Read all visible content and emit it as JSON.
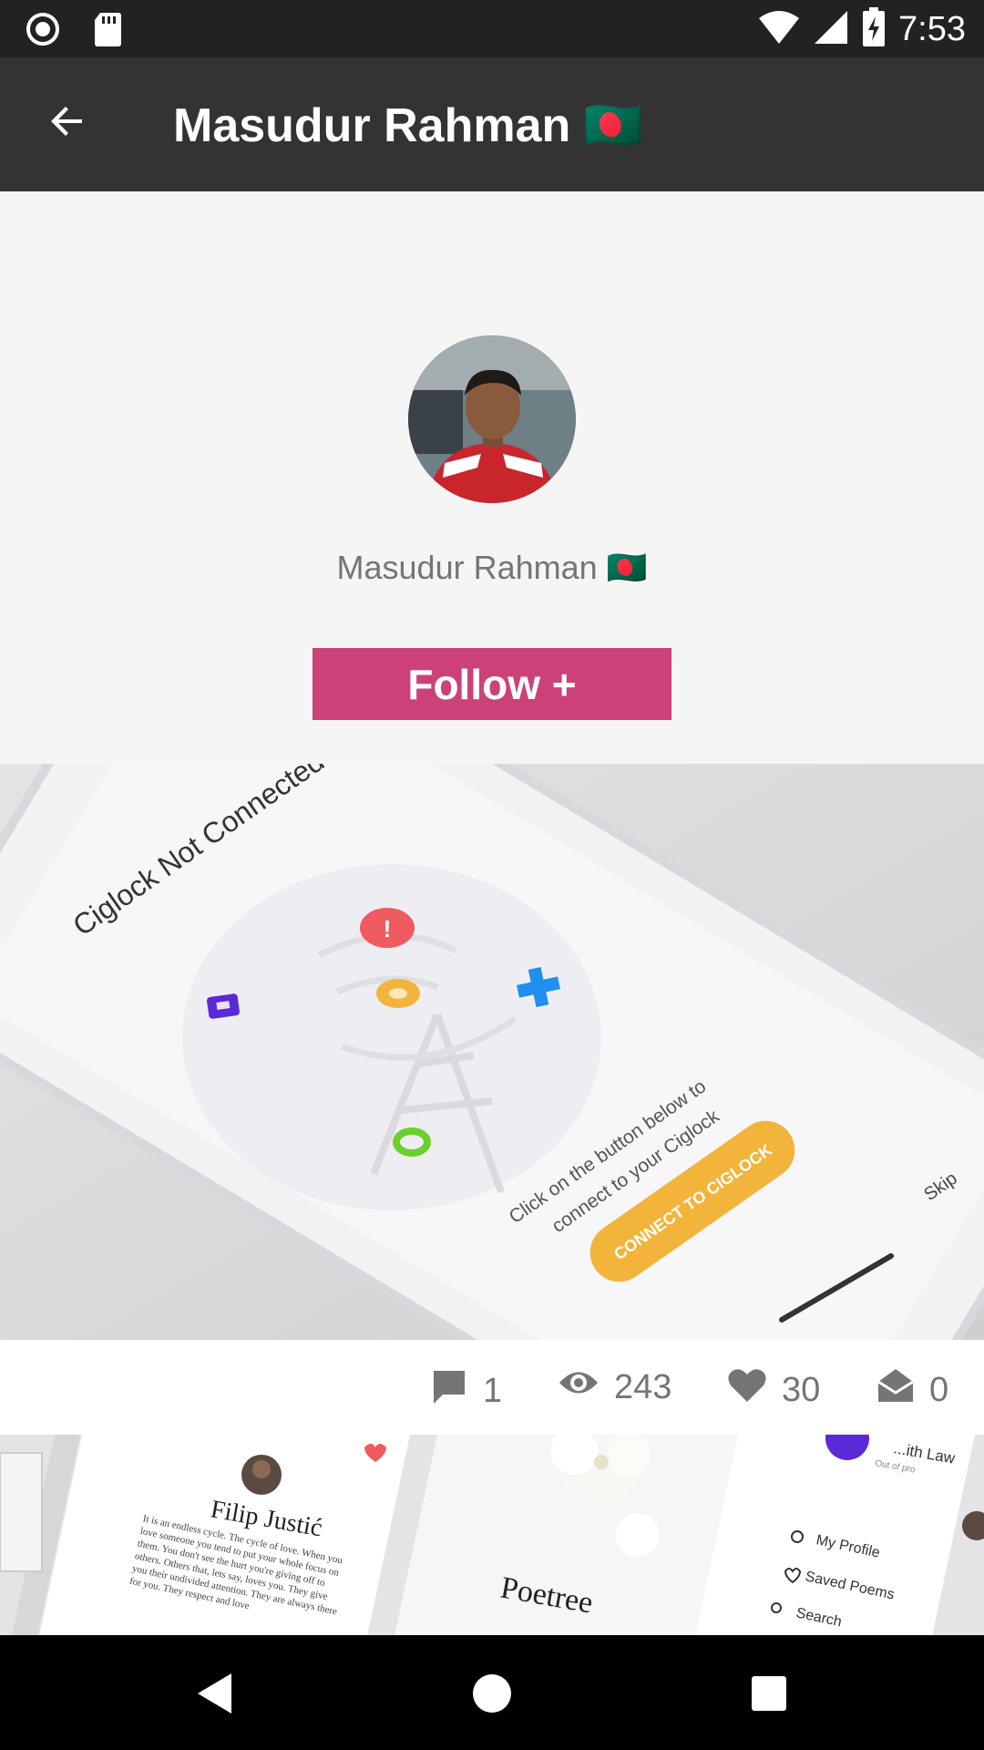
{
  "status_bar": {
    "time": "7:53",
    "icons": [
      "record-icon",
      "sd-card-icon",
      "wifi-icon",
      "signal-icon",
      "battery-charging-icon"
    ]
  },
  "app_bar": {
    "title": "Masudur Rahman 🇧🇩",
    "back_icon": "arrow-left-icon"
  },
  "profile": {
    "name": "Masudur Rahman 🇧🇩",
    "follow_label": "Follow +"
  },
  "post": {
    "image": {
      "heading": "Ciglock Not Connected",
      "body_line1": "Click on the button below to",
      "body_line2": "connect to your Ciglock",
      "cta": "CONNECT TO CIGLOCK",
      "skip": "Skip"
    },
    "stats": {
      "comments": "1",
      "views": "243",
      "likes": "30",
      "shares": "0"
    }
  },
  "post2": {
    "card1_name": "Filip Justić",
    "card1_text": "It is an endless cycle. The cycle of love. When you love someone you tend to put your whole focus on them. You don't see the hurt you're giving off to others. Others that, lets say, loves you. They give you their undivided attention. They are always there for you. They respect and love",
    "card2_title": "Poetree",
    "card3_law": "...ith Law",
    "card3_sub": "Out of pro",
    "menu": [
      "My Profile",
      "Saved Poems",
      "Search"
    ]
  },
  "colors": {
    "status_bar": "#222222",
    "app_bar": "#333333",
    "follow_button": "#cc4278",
    "cta_yellow": "#f2b43a"
  }
}
